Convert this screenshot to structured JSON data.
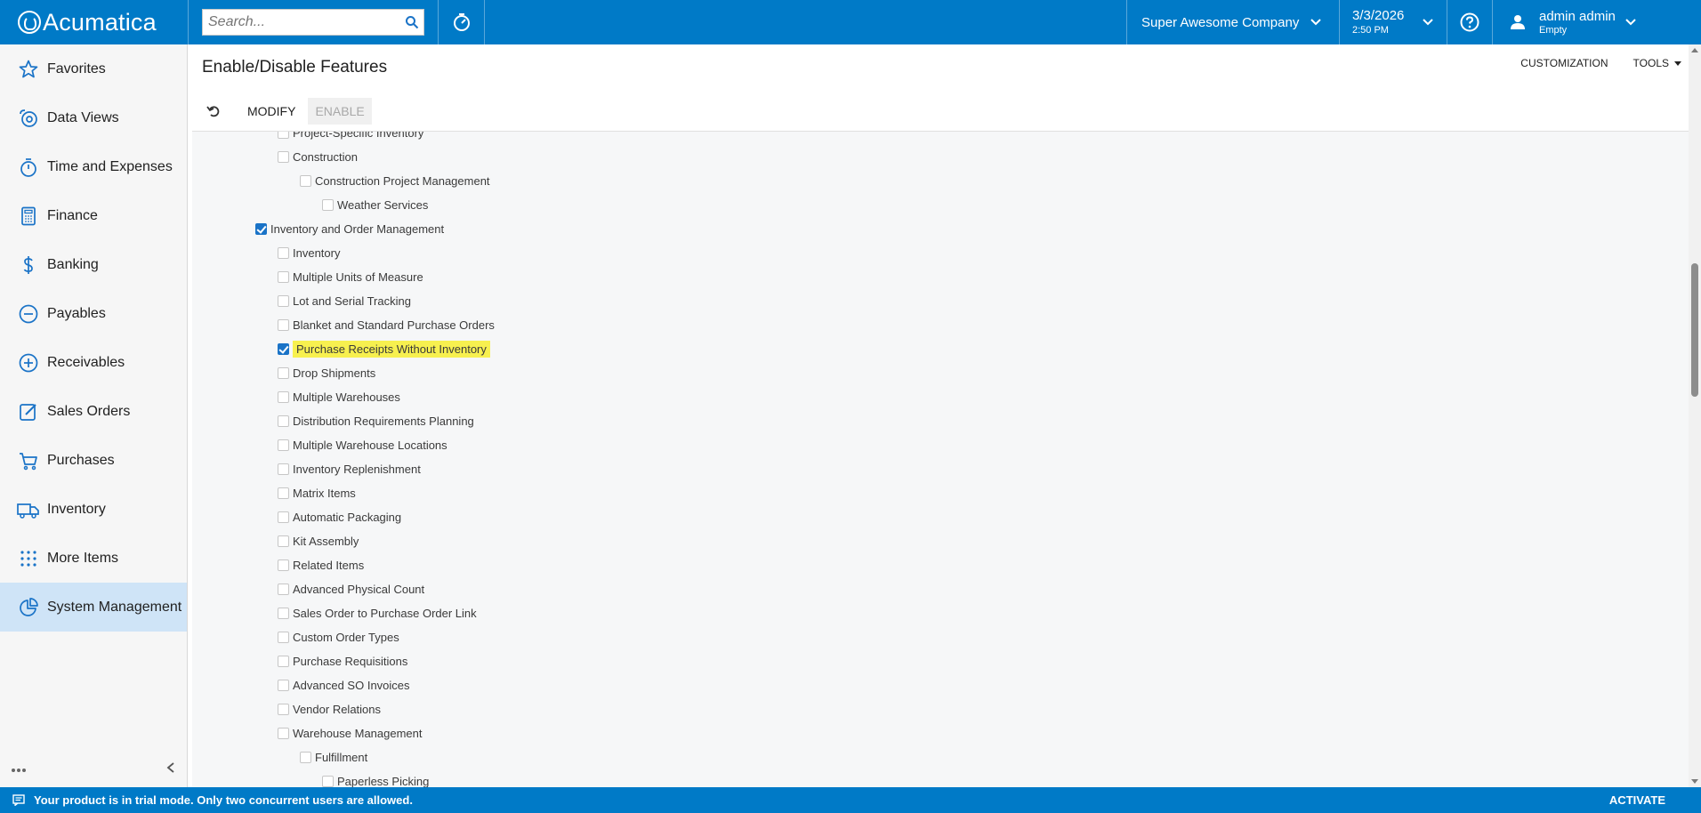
{
  "brand": {
    "name": "Acumatica"
  },
  "header": {
    "search_placeholder": "Search...",
    "company": "Super Awesome Company",
    "date": "3/3/2026",
    "time": "2:50 PM",
    "user_name": "admin admin",
    "user_status": "Empty"
  },
  "sidebar": {
    "items": [
      {
        "label": "Favorites",
        "icon": "star-icon"
      },
      {
        "label": "Data Views",
        "icon": "data-views-icon"
      },
      {
        "label": "Time and Expenses",
        "icon": "stopwatch-icon"
      },
      {
        "label": "Finance",
        "icon": "calculator-icon"
      },
      {
        "label": "Banking",
        "icon": "dollar-icon"
      },
      {
        "label": "Payables",
        "icon": "minus-circle-icon"
      },
      {
        "label": "Receivables",
        "icon": "plus-circle-icon"
      },
      {
        "label": "Sales Orders",
        "icon": "edit-icon"
      },
      {
        "label": "Purchases",
        "icon": "cart-icon"
      },
      {
        "label": "Inventory",
        "icon": "truck-icon"
      },
      {
        "label": "More Items",
        "icon": "grid-icon"
      },
      {
        "label": "System Management",
        "icon": "pie-chart-icon",
        "active": true
      }
    ]
  },
  "page": {
    "title": "Enable/Disable Features",
    "customization": "CUSTOMIZATION",
    "tools": "TOOLS"
  },
  "toolbar": {
    "modify": "MODIFY",
    "enable": "ENABLE"
  },
  "features": [
    {
      "label": "Project-Specific Inventory",
      "level": 2,
      "checked": false
    },
    {
      "label": "Construction",
      "level": 2,
      "checked": false
    },
    {
      "label": "Construction Project Management",
      "level": 3,
      "checked": false
    },
    {
      "label": "Weather Services",
      "level": 4,
      "checked": false
    },
    {
      "label": "Inventory and Order Management",
      "level": 1,
      "checked": true
    },
    {
      "label": "Inventory",
      "level": 2,
      "checked": false
    },
    {
      "label": "Multiple Units of Measure",
      "level": 2,
      "checked": false
    },
    {
      "label": "Lot and Serial Tracking",
      "level": 2,
      "checked": false
    },
    {
      "label": "Blanket and Standard Purchase Orders",
      "level": 2,
      "checked": false
    },
    {
      "label": "Purchase Receipts Without Inventory",
      "level": 2,
      "checked": true,
      "highlighted": true
    },
    {
      "label": "Drop Shipments",
      "level": 2,
      "checked": false
    },
    {
      "label": "Multiple Warehouses",
      "level": 2,
      "checked": false
    },
    {
      "label": "Distribution Requirements Planning",
      "level": 2,
      "checked": false
    },
    {
      "label": "Multiple Warehouse Locations",
      "level": 2,
      "checked": false
    },
    {
      "label": "Inventory Replenishment",
      "level": 2,
      "checked": false
    },
    {
      "label": "Matrix Items",
      "level": 2,
      "checked": false
    },
    {
      "label": "Automatic Packaging",
      "level": 2,
      "checked": false
    },
    {
      "label": "Kit Assembly",
      "level": 2,
      "checked": false
    },
    {
      "label": "Related Items",
      "level": 2,
      "checked": false
    },
    {
      "label": "Advanced Physical Count",
      "level": 2,
      "checked": false
    },
    {
      "label": "Sales Order to Purchase Order Link",
      "level": 2,
      "checked": false
    },
    {
      "label": "Custom Order Types",
      "level": 2,
      "checked": false
    },
    {
      "label": "Purchase Requisitions",
      "level": 2,
      "checked": false
    },
    {
      "label": "Advanced SO Invoices",
      "level": 2,
      "checked": false
    },
    {
      "label": "Vendor Relations",
      "level": 2,
      "checked": false
    },
    {
      "label": "Warehouse Management",
      "level": 2,
      "checked": false
    },
    {
      "label": "Fulfillment",
      "level": 3,
      "checked": false
    },
    {
      "label": "Paperless Picking",
      "level": 4,
      "checked": false
    }
  ],
  "footer": {
    "message": "Your product is in trial mode. Only two concurrent users are allowed.",
    "activate": "ACTIVATE"
  },
  "colors": {
    "brand_blue": "#007ac7",
    "active_nav": "#cfe4f7",
    "highlight": "#f7f04f"
  }
}
